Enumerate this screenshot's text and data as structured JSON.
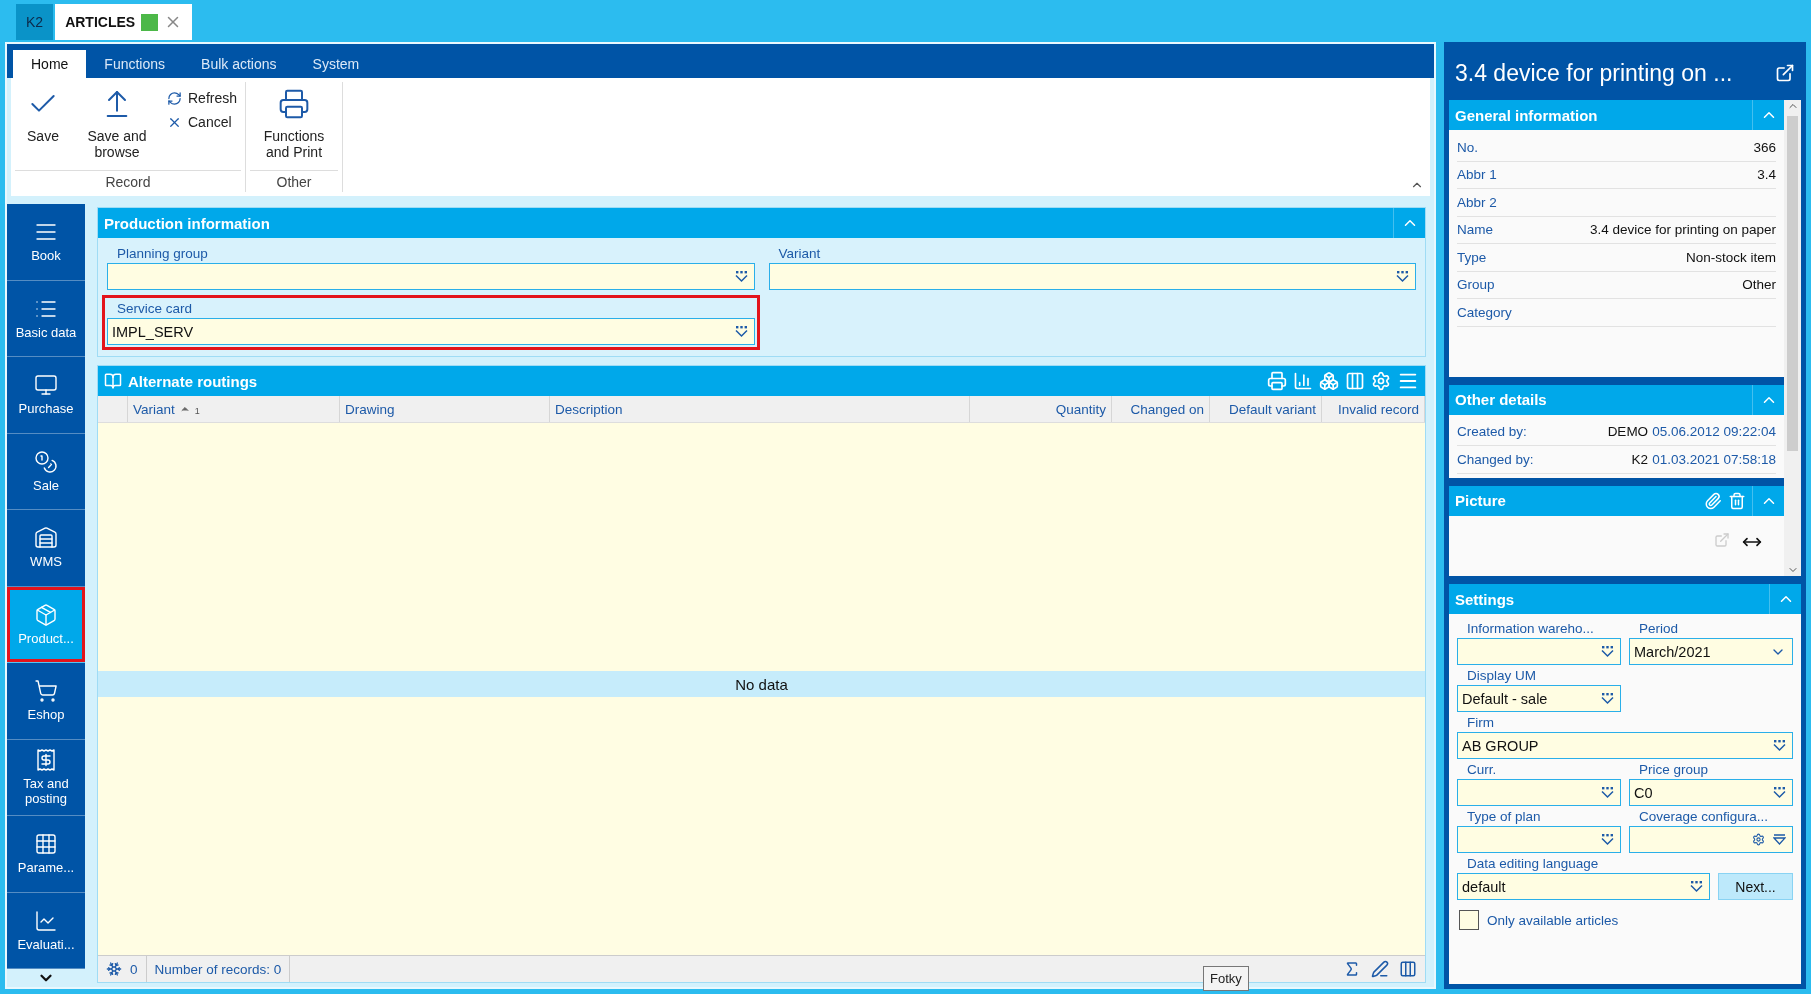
{
  "top_tabs": [
    {
      "label": "K2",
      "selected": false
    },
    {
      "label": "ARTICLES",
      "selected": true,
      "color": "#4cb848"
    }
  ],
  "ribbon": {
    "tabs": [
      {
        "label": "Home",
        "selected": true
      },
      {
        "label": "Functions",
        "selected": false
      },
      {
        "label": "Bulk actions",
        "selected": false
      },
      {
        "label": "System",
        "selected": false
      }
    ],
    "groups": [
      {
        "label": "Record",
        "buttons": [
          {
            "kind": "large",
            "label": "Save"
          },
          {
            "kind": "large",
            "label": "Save and browse"
          },
          {
            "kind": "small",
            "label": "Refresh"
          },
          {
            "kind": "small",
            "label": "Cancel"
          }
        ]
      },
      {
        "label": "Other",
        "buttons": [
          {
            "kind": "large",
            "label": "Functions and Print"
          }
        ]
      }
    ]
  },
  "sidebar": {
    "items": [
      {
        "label": "Book",
        "selected": false,
        "highlighted": false
      },
      {
        "label": "Basic data",
        "selected": false,
        "highlighted": false
      },
      {
        "label": "Purchase",
        "selected": false,
        "highlighted": false
      },
      {
        "label": "Sale",
        "selected": false,
        "highlighted": false
      },
      {
        "label": "WMS",
        "selected": false,
        "highlighted": false
      },
      {
        "label": "Product...",
        "selected": true,
        "highlighted": true
      },
      {
        "label": "Eshop",
        "selected": false,
        "highlighted": false
      },
      {
        "label": "Tax and posting",
        "selected": false,
        "highlighted": false
      },
      {
        "label": "Parame...",
        "selected": false,
        "highlighted": false
      },
      {
        "label": "Evaluati...",
        "selected": false,
        "highlighted": false
      }
    ]
  },
  "production": {
    "title": "Production information",
    "fields": [
      {
        "label": "Planning group",
        "highlighted": false
      },
      {
        "label": "Variant",
        "highlighted": false
      },
      {
        "label": "Service card",
        "value": "IMPL_SERV",
        "highlighted": true
      }
    ]
  },
  "routings": {
    "title": "Alternate routings",
    "columns": [
      {
        "label": "Variant",
        "sorted": true,
        "sort_order": "1"
      },
      {
        "label": "Drawing",
        "sorted": false
      },
      {
        "label": "Description",
        "sorted": false
      },
      {
        "label": "Quantity",
        "sorted": false
      },
      {
        "label": "Changed on",
        "sorted": false
      },
      {
        "label": "Default variant",
        "sorted": false
      },
      {
        "label": "Invalid record",
        "sorted": false
      }
    ],
    "empty_text": "No data",
    "footer": {
      "count": "0",
      "records": "Number of records: 0"
    }
  },
  "tooltip": "Fotky",
  "detail": {
    "title": "3.4 device for printing on ...",
    "general": {
      "title": "General information",
      "rows": [
        {
          "label": "No.",
          "value": "366"
        },
        {
          "label": "Abbr 1",
          "value": "3.4"
        },
        {
          "label": "Abbr 2"
        },
        {
          "label": "Name",
          "value": "3.4 device for printing on paper"
        },
        {
          "label": "Type",
          "value": "Non-stock item"
        },
        {
          "label": "Group",
          "value": "Other"
        },
        {
          "label": "Category"
        }
      ]
    },
    "other": {
      "title": "Other details",
      "rows": [
        {
          "label": "Created by:",
          "user": "DEMO",
          "date": "05.06.2012 09:22:04"
        },
        {
          "label": "Changed by:",
          "user": "K2",
          "date": "01.03.2021 07:58:18"
        }
      ]
    },
    "picture": {
      "title": "Picture"
    },
    "settings": {
      "title": "Settings",
      "fields": [
        {
          "label": "Information wareho...",
          "kind": "lookup"
        },
        {
          "label": "Period",
          "value": "March/2021",
          "kind": "select"
        },
        {
          "label": "Display UM",
          "value": "Default - sale",
          "kind": "lookup"
        },
        {
          "label": "Firm",
          "value": "AB GROUP",
          "kind": "lookup"
        },
        {
          "label": "Curr.",
          "kind": "lookup"
        },
        {
          "label": "Price group",
          "value": "C0",
          "kind": "lookup"
        },
        {
          "label": "Type of plan",
          "kind": "lookup"
        },
        {
          "label": "Coverage configura...",
          "kind": "config"
        },
        {
          "label": "Data editing language",
          "value": "default",
          "kind": "lookup"
        }
      ],
      "button": "Next...",
      "checkbox": {
        "label": "Only available articles",
        "checked": false
      }
    }
  }
}
